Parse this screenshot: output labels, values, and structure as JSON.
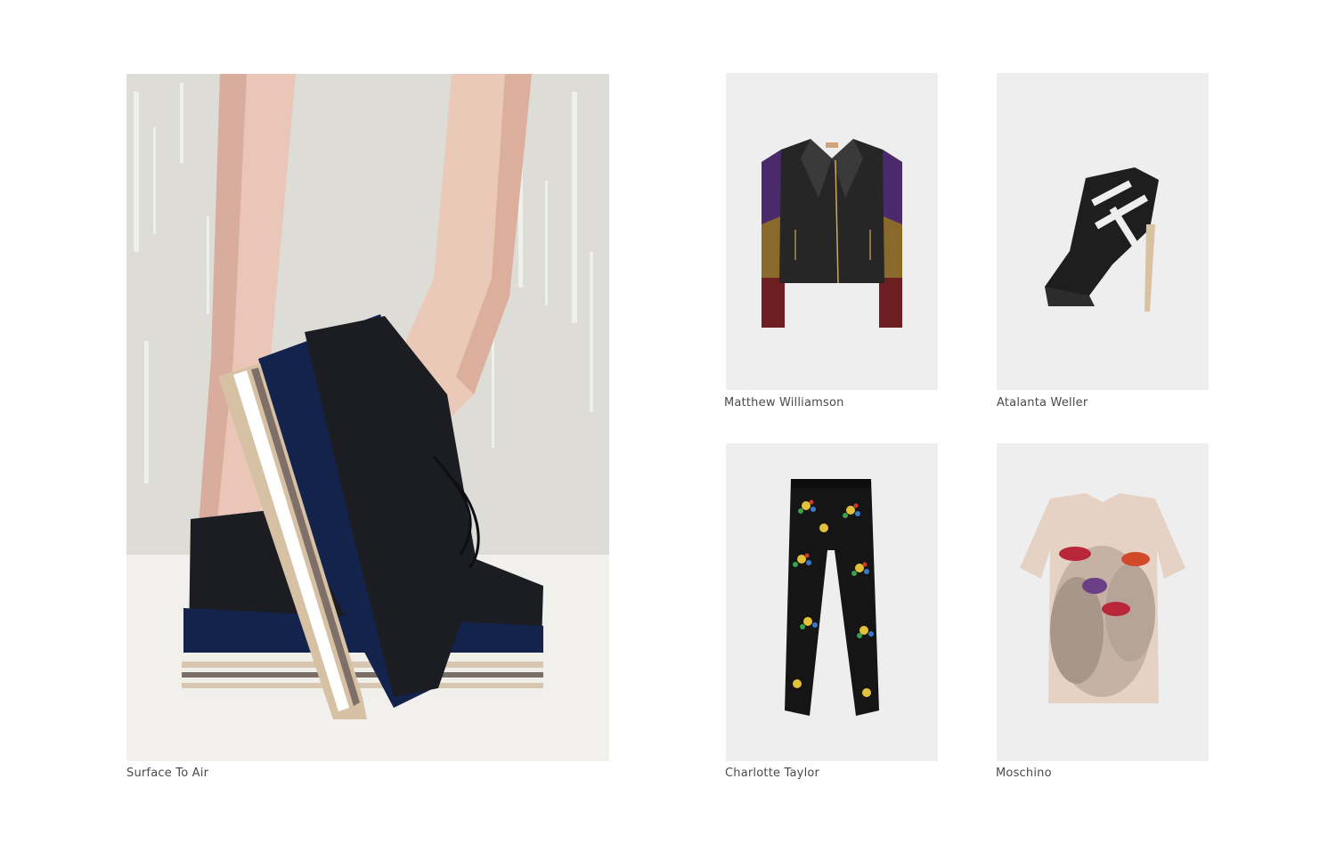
{
  "gallery": {
    "hero": {
      "caption": "Surface To Air",
      "image_subject": "platform-shoes-photo"
    },
    "products": [
      {
        "caption": "Matthew Williamson",
        "image_subject": "leather-jacket-photo"
      },
      {
        "caption": "Atalanta Weller",
        "image_subject": "high-heel-bootie-photo"
      },
      {
        "caption": "Charlotte Taylor",
        "image_subject": "printed-trousers-photo"
      },
      {
        "caption": "Moschino",
        "image_subject": "face-print-tshirt-photo"
      }
    ]
  }
}
